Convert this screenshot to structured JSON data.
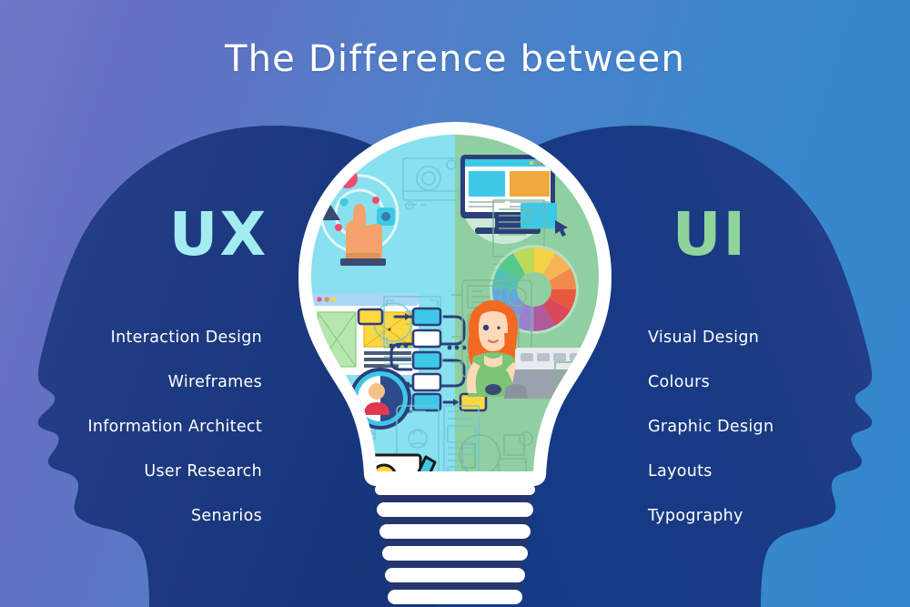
{
  "title": "The Difference between",
  "background": {
    "gradient_from": "#6d77c6",
    "gradient_to": "#3287cc",
    "head_color": "#1b3a79"
  },
  "left_panel": {
    "heading": "UX",
    "heading_color": "#a5ebf2",
    "items": [
      {
        "label": "Interaction Design"
      },
      {
        "label": "Wireframes"
      },
      {
        "label": "Information Architect"
      },
      {
        "label": "User Research"
      },
      {
        "label": "Senarios"
      }
    ]
  },
  "right_panel": {
    "heading": "UI",
    "heading_color": "#8ed49b",
    "items": [
      {
        "label": "Visual Design"
      },
      {
        "label": "Colours"
      },
      {
        "label": "Graphic Design"
      },
      {
        "label": "Layouts"
      },
      {
        "label": "Typography"
      }
    ]
  },
  "bulb": {
    "left_fill": "#89e0ee",
    "right_fill": "#8fcfa1",
    "outline": "#ffffff",
    "base_band": "#ffffff",
    "base_gap": "#24356f",
    "left_icons": [
      "touch-interaction-icon",
      "camera-outline-icon",
      "browser-wireframe-icon",
      "circle-diagram-outline-icon",
      "image-placeholder-outline-icon",
      "flowchart-sitemap-icon",
      "magnifier-persona-icon",
      "mobile-wireframe-outline-icon",
      "document-stack-pen-icon"
    ],
    "right_icons": [
      "desktop-design-app-icon",
      "text-document-outline-icon",
      "color-wheel-icon",
      "device-blueprint-outline-icon",
      "designer-woman-icon",
      "checklist-outline-icon",
      "shapes-outline-icon",
      "ui-layout-swatches-icon",
      "typography-aa-pen-icon"
    ]
  },
  "palette": {
    "cyan": "#3ec8e8",
    "yellow": "#ffd740",
    "navy": "#2d3f7a",
    "orange": "#f0894a",
    "pink": "#ef4b72",
    "green_leaf": "#7cc576",
    "white": "#ffffff",
    "grey": "#b9c2cc"
  }
}
